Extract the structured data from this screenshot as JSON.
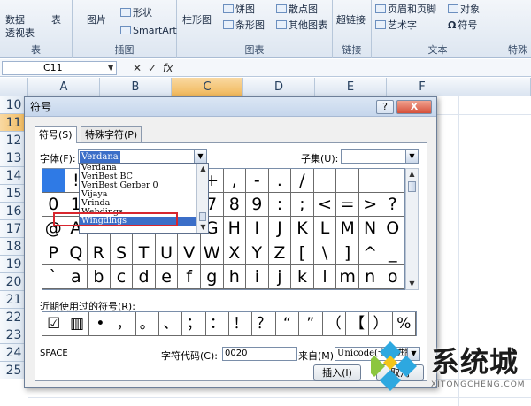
{
  "ribbon": {
    "groups": [
      {
        "title": "表",
        "items": [
          "数据",
          "透视表",
          "表"
        ]
      },
      {
        "title": "插图",
        "items": [
          "图片",
          "形状",
          "SmartArt"
        ]
      },
      {
        "title": "图表",
        "items": [
          "柱形图",
          "饼图",
          "条形图",
          "散点图",
          "其他图表"
        ]
      },
      {
        "title": "链接",
        "items": [
          "超链接"
        ]
      },
      {
        "title": "文本",
        "items": [
          "页眉和页脚",
          "艺术字",
          "符号",
          "对象"
        ]
      },
      {
        "title": "特殊",
        "items": []
      }
    ]
  },
  "formula_bar": {
    "cell_ref": "C11",
    "fx": "fx"
  },
  "sheet": {
    "columns": [
      "A",
      "B",
      "C",
      "D",
      "E",
      "F"
    ],
    "selected_column": "C",
    "rows": [
      "10",
      "11",
      "12",
      "13",
      "14",
      "15",
      "16",
      "17",
      "18",
      "19",
      "20",
      "21",
      "22",
      "23",
      "24",
      "25"
    ],
    "selected_row": "11"
  },
  "dialog": {
    "title": "符号",
    "help_btn": "?",
    "close_btn": "X",
    "tabs": [
      "符号(S)",
      "特殊字符(P)"
    ],
    "font_label": "字体(F):",
    "font_value": "Verdana",
    "subset_label": "子集(U):",
    "subset_value": "",
    "font_list": [
      "Verdana",
      "VeriBest BC",
      "VeriBest Gerber 0",
      "Vijaya",
      "Vrinda",
      "Webdings",
      "Wingdings"
    ],
    "font_list_highlight": "Wingdings",
    "symbols": [
      "",
      "!",
      "\"",
      "#",
      "(",
      ")",
      "*",
      "+",
      ",",
      "-",
      ".",
      "/",
      "",
      "",
      "",
      "",
      "0",
      "1",
      "2",
      "3",
      "4",
      "5",
      "6",
      "7",
      "8",
      "9",
      ":",
      ";",
      "<",
      "=",
      ">",
      "?",
      "@",
      "A",
      "B",
      "C",
      "D",
      "E",
      "F",
      "G",
      "H",
      "I",
      "J",
      "K",
      "L",
      "M",
      "N",
      "O",
      "P",
      "Q",
      "R",
      "S",
      "T",
      "U",
      "V",
      "W",
      "X",
      "Y",
      "Z",
      "[",
      "\\",
      "]",
      "^",
      "_",
      "`",
      "a",
      "b",
      "c",
      "d",
      "e",
      "f",
      "g",
      "h",
      "i",
      "j",
      "k",
      "l",
      "m",
      "n",
      "o"
    ],
    "recent_label": "近期使用过的符号(R):",
    "recent_symbols": [
      "☑",
      "▥",
      "•",
      "，",
      "。",
      "、",
      "；",
      "：",
      "！",
      "？",
      "“",
      "”",
      "（",
      "【",
      "）",
      "%"
    ],
    "char_name": "SPACE",
    "char_code_label": "字符代码(C):",
    "char_code": "0020",
    "from_label": "来自(M):",
    "from_value": "Unicode(十六进制)",
    "insert_btn": "插入(I)",
    "cancel_btn": "取消"
  },
  "watermark": {
    "word": "系统城",
    "url": "XITONGCHENG.COM"
  }
}
